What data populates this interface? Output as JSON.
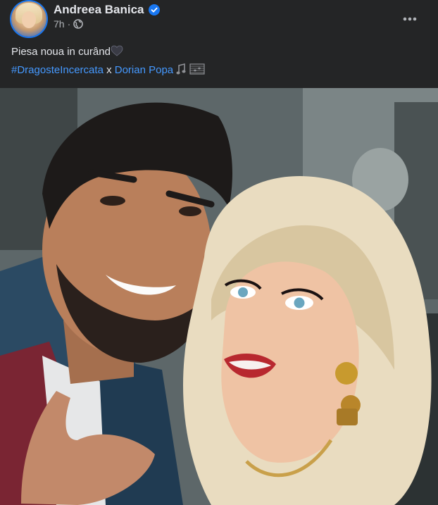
{
  "post": {
    "author": "Andreea Banica",
    "time": "7h",
    "text_line1": "Piesa noua in curând",
    "hashtag": "#DragosteIncercata",
    "connector": " x ",
    "mention": "Dorian Popa"
  },
  "colors": {
    "background": "#242526",
    "text": "#e4e6eb",
    "secondary_text": "#b0b3b8",
    "link": "#4599ff",
    "verified": "#1877f2"
  },
  "icons": {
    "verified": "verified-badge-icon",
    "privacy": "globe-icon",
    "more": "more-options-icon",
    "heart": "black-heart-icon",
    "music": "musical-notes-icon"
  }
}
